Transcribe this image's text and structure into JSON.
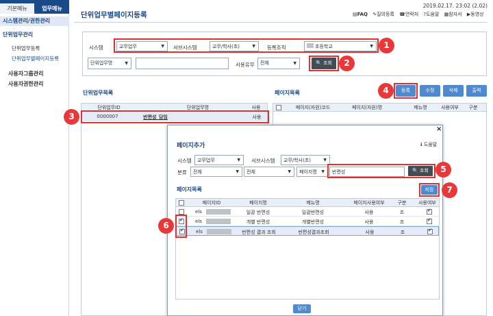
{
  "sidebar": {
    "tab_basic": "기본메뉴",
    "tab_work": "업무메뉴",
    "header": "시스템관리/권한관리",
    "section1": "단위업무관리",
    "items": [
      "단위업무등록",
      "단위업무별페이지등록"
    ],
    "section2": "사용자그룹관리",
    "section3": "사용자권한관리"
  },
  "header": {
    "datetime": "2019.02.17. 23:02 (2.02)",
    "title": "단위업무별페이지등록",
    "links": [
      "FAQ",
      "질의등록",
      "연락처",
      "도움말",
      "참자서",
      "동영상"
    ]
  },
  "search": {
    "system_label": "시스템",
    "system_value": "교무업무",
    "subsystem_label": "서브시스템",
    "subsystem_value": "교무/학사(초)",
    "org_label": "등록조직",
    "org_value": "초등학교",
    "unit_select": "단위업무명",
    "use_label": "사용유무",
    "use_value": "전체",
    "search_button": "조회"
  },
  "badges": [
    "1",
    "2",
    "3",
    "4",
    "5",
    "6",
    "7"
  ],
  "unit_list": {
    "title": "단위업무목록",
    "columns": [
      "단위업무ID",
      "단위업무명",
      "사용"
    ],
    "rows": [
      {
        "id": "0000007",
        "name": "반편성_담임",
        "use": "사용"
      }
    ]
  },
  "page_list": {
    "title": "페이지목록",
    "columns": [
      "페이지(자원)코드",
      "페이지(자원)명",
      "메뉴명",
      "사용여부",
      "구분"
    ],
    "buttons": {
      "register": "등록",
      "edit": "수정",
      "delete": "삭제",
      "print": "출력"
    }
  },
  "modal": {
    "close": "×",
    "title": "페이지추가",
    "help": "도움말",
    "system_label": "시스템",
    "system_value": "교무업무",
    "subsystem_label": "서브시스템",
    "subsystem_value": "교무/학사(초)",
    "category_label": "분류",
    "cat1": "전체",
    "cat2": "전체",
    "page_select": "페이지명",
    "search_text": "반편성",
    "search_button": "조회",
    "list_title": "페이지목록",
    "save_button": "저장",
    "columns": [
      "페이지ID",
      "페이지명",
      "메뉴명",
      "페이지사용여부",
      "구분",
      "사용여부"
    ],
    "rows": [
      {
        "id": "els",
        "name": "일괄 반편성",
        "menu": "일괄반편성",
        "use": "사용",
        "type": "조",
        "checked": false
      },
      {
        "id": "els",
        "name": "개별 반편성",
        "menu": "개별반편성",
        "use": "사용",
        "type": "조",
        "checked": true
      },
      {
        "id": "els",
        "name": "반편성 결과 조회",
        "menu": "반편성결과조회",
        "use": "사용",
        "type": "조",
        "checked": true
      }
    ],
    "close_button": "닫기"
  }
}
